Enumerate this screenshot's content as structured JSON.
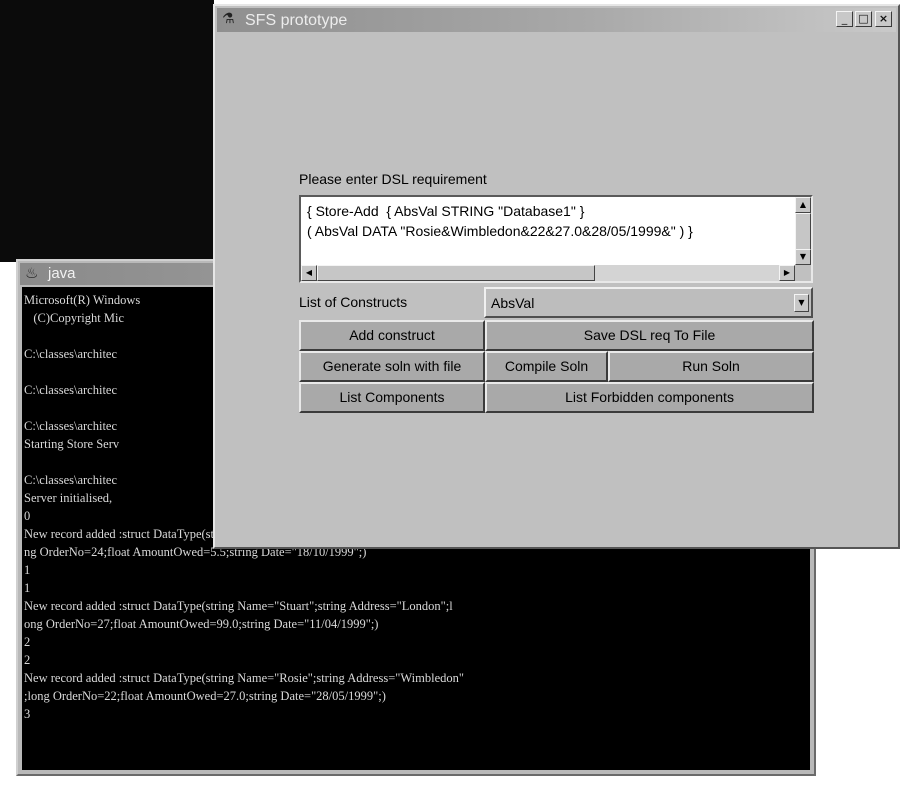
{
  "console": {
    "title": "java",
    "icon": "java-cup-icon",
    "lines": [
      "Microsoft(R) Windows",
      "   (C)Copyright Mic",
      "",
      "C:\\classes\\architec",
      "",
      "C:\\classes\\architec",
      "",
      "C:\\classes\\architec",
      "Starting Store Serv",
      "",
      "C:\\classes\\architec",
      "Server initialised,",
      "0",
      "New record added :struct DataType(string Name=\"James\";string Address=\"Durham\";lo",
      "ng OrderNo=24;float AmountOwed=5.5;string Date=\"18/10/1999\";)",
      "1",
      "1",
      "New record added :struct DataType(string Name=\"Stuart\";string Address=\"London\";l",
      "ong OrderNo=27;float AmountOwed=99.0;string Date=\"11/04/1999\";)",
      "2",
      "2",
      "New record added :struct DataType(string Name=\"Rosie\";string Address=\"Wimbledon\"",
      ";long OrderNo=22;float AmountOwed=27.0;string Date=\"28/05/1999\";)",
      "3"
    ]
  },
  "sfs": {
    "title": "SFS prototype",
    "icon": "app-icon",
    "window_buttons": {
      "minimize": "_",
      "maximize": "□",
      "close": "×"
    },
    "prompt_label": "Please enter DSL requirement",
    "dsl_text": "{ Store-Add  { AbsVal STRING \"Database1\" }\n( AbsVal DATA \"Rosie&Wimbledon&22&27.0&28/05/1999&\" ) }",
    "constructs_label": "List of Constructs",
    "constructs_selected": "AbsVal",
    "buttons": {
      "add_construct": "Add construct",
      "save_dsl": "Save DSL req To File",
      "generate_soln": "Generate soln with file",
      "compile_soln": "Compile Soln",
      "run_soln": "Run Soln",
      "list_components": "List Components",
      "list_forbidden": "List Forbidden components"
    }
  },
  "colors": {
    "window_face": "#c0c0c0",
    "console_background": "#000000",
    "console_text": "#d9d9d9",
    "button_face": "#a9a9a9"
  }
}
